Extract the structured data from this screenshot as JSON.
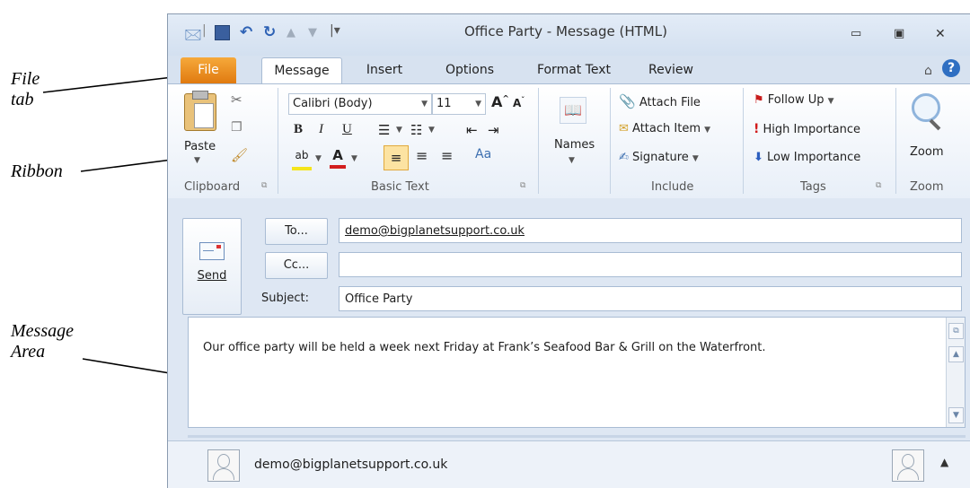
{
  "annotations": {
    "file_tab": [
      "File",
      "tab"
    ],
    "ribbon": "Ribbon",
    "message_area": [
      "Message",
      "Area"
    ]
  },
  "window": {
    "title": "Office Party - Message (HTML)"
  },
  "tabs": [
    "File",
    "Message",
    "Insert",
    "Options",
    "Format Text",
    "Review"
  ],
  "ribbon": {
    "clipboard": {
      "label": "Clipboard",
      "paste": "Paste"
    },
    "basic_text": {
      "label": "Basic Text",
      "font": "Calibri (Body)",
      "size": "11"
    },
    "names": {
      "label": "Names"
    },
    "include": {
      "label": "Include",
      "attach_file": "Attach File",
      "attach_item": "Attach Item",
      "signature": "Signature"
    },
    "tags": {
      "label": "Tags",
      "follow_up": "Follow Up",
      "high": "High Importance",
      "low": "Low Importance"
    },
    "zoom": {
      "label": "Zoom",
      "button": "Zoom"
    }
  },
  "compose": {
    "send": "Send",
    "to_button": "To...",
    "cc_button": "Cc...",
    "subject_label": "Subject:",
    "to_value": "demo@bigplanetsupport.co.uk",
    "cc_value": "",
    "subject_value": "Office Party",
    "body": "Our office party will be held a week next Friday at Frank’s Seafood Bar & Grill on the Waterfront."
  },
  "people_pane": {
    "contact": "demo@bigplanetsupport.co.uk"
  },
  "colors": {
    "file_tab": "#e8861c",
    "accent_blue": "#1f5fb8"
  }
}
